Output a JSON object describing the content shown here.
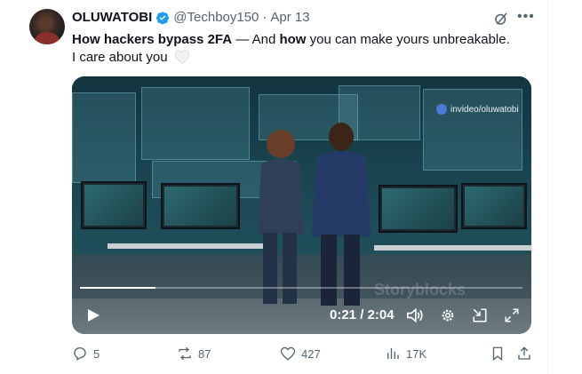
{
  "tweet": {
    "author_name": "OLUWATOBI",
    "handle": "@Techboy150",
    "separator": "·",
    "date": "Apr 13",
    "text_bold_1": "How hackers bypass 2FA",
    "text_mid": " — And ",
    "text_bold_2": "how",
    "text_rest": " you can make yours unbreakable.",
    "text_line2": "I care about you"
  },
  "media": {
    "watermark": "invideo/oluwatobi",
    "stock_watermark": "Storyblocks",
    "time_display": "0:21 / 2:04",
    "progress": 0.17
  },
  "actions": {
    "replies": "5",
    "reposts": "87",
    "likes": "427",
    "views": "17K"
  },
  "colors": {
    "verified": "#1d9bf0",
    "muted": "#536471",
    "text": "#0f1419"
  }
}
